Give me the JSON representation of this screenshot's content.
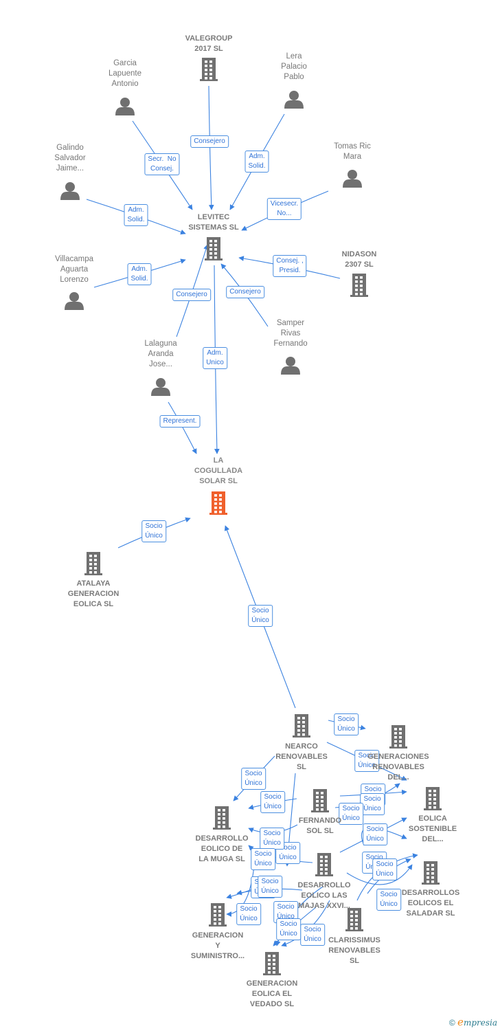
{
  "colors": {
    "edge": "#3b82e0",
    "icon": "#707070",
    "highlight": "#f0602c",
    "label": "#777777"
  },
  "nodes": [
    {
      "name": "VALEGROUP 2017  SL",
      "lines": [
        "VALEGROUP",
        "2017  SL"
      ],
      "type": "company"
    },
    {
      "name": "Garcia Lapuente Antonio",
      "lines": [
        "Garcia",
        "Lapuente",
        "Antonio"
      ],
      "type": "person"
    },
    {
      "name": "Lera Palacio Pablo",
      "lines": [
        "Lera",
        "Palacio",
        "Pablo"
      ],
      "type": "person"
    },
    {
      "name": "Galindo Salvador Jaime...",
      "lines": [
        "Galindo",
        "Salvador",
        "Jaime..."
      ],
      "type": "person"
    },
    {
      "name": "Tomas Ric Mara",
      "lines": [
        "Tomas Ric",
        "Mara"
      ],
      "type": "person"
    },
    {
      "name": "LEVITEC SISTEMAS SL",
      "lines": [
        "LEVITEC",
        "SISTEMAS  SL"
      ],
      "type": "company"
    },
    {
      "name": "Villacampa Aguarta Lorenzo",
      "lines": [
        "Villacampa",
        "Aguarta",
        "Lorenzo"
      ],
      "type": "person"
    },
    {
      "name": "NIDASON 2307 SL",
      "lines": [
        "NIDASON",
        "2307  SL"
      ],
      "type": "company"
    },
    {
      "name": "Samper Rivas Fernando",
      "lines": [
        "Samper",
        "Rivas",
        "Fernando"
      ],
      "type": "person"
    },
    {
      "name": "Lalaguna Aranda Jose...",
      "lines": [
        "Lalaguna",
        "Aranda",
        "Jose..."
      ],
      "type": "person"
    },
    {
      "name": "LA COGULLADA SOLAR SL",
      "lines": [
        "LA",
        "COGULLADA",
        "SOLAR  SL"
      ],
      "type": "company",
      "highlight": true
    },
    {
      "name": "ATALAYA GENERACION EOLICA SL",
      "lines": [
        "ATALAYA",
        "GENERACION",
        "EOLICA  SL"
      ],
      "type": "company"
    },
    {
      "name": "NEARCO RENOVABLES SL",
      "lines": [
        "NEARCO",
        "RENOVABLES",
        "SL"
      ],
      "type": "company"
    },
    {
      "name": "GENERACIONES RENOVABLES DEL...",
      "lines": [
        "GENERACIONES",
        "RENOVABLES",
        "DEL..."
      ],
      "type": "company"
    },
    {
      "name": "FERNANDO SOL SL",
      "lines": [
        "FERNANDO",
        "SOL SL"
      ],
      "type": "company"
    },
    {
      "name": "EOLICA SOSTENIBLE DEL...",
      "lines": [
        "EOLICA",
        "SOSTENIBLE",
        "DEL..."
      ],
      "type": "company"
    },
    {
      "name": "DESARROLLO EOLICO DE LA MUGA SL",
      "lines": [
        "DESARROLLO",
        "EOLICO DE",
        "LA MUGA SL"
      ],
      "type": "company"
    },
    {
      "name": "DESARROLLO EOLICO LAS MAJAS XXVI...",
      "lines": [
        "DESARROLLO",
        "EOLICO LAS",
        "MAJAS XXVI..."
      ],
      "type": "company"
    },
    {
      "name": "DESARROLLOS EOLICOS EL SALADAR SL",
      "lines": [
        "DESARROLLOS",
        "EOLICOS EL",
        "SALADAR SL"
      ],
      "type": "company"
    },
    {
      "name": "CLARISSIMUS RENOVABLES SL",
      "lines": [
        "CLARISSIMUS",
        "RENOVABLES",
        "SL"
      ],
      "type": "company"
    },
    {
      "name": "GENERACION Y SUMINISTRO...",
      "lines": [
        "GENERACION",
        "Y",
        "SUMINISTRO..."
      ],
      "type": "company"
    },
    {
      "name": "GENERACION EOLICA EL VEDADO SL",
      "lines": [
        "GENERACION",
        "EOLICA EL",
        "VEDADO SL"
      ],
      "type": "company"
    }
  ],
  "edges": [
    {
      "from": 1,
      "to": 5,
      "label": "Secr.  No\nConsej."
    },
    {
      "from": 0,
      "to": 5,
      "label": "Consejero"
    },
    {
      "from": 2,
      "to": 5,
      "label": "Adm.\nSolid."
    },
    {
      "from": 3,
      "to": 5,
      "label": "Adm.\nSolid."
    },
    {
      "from": 4,
      "to": 5,
      "label": "Vicesecr.\nNo..."
    },
    {
      "from": 6,
      "to": 5,
      "label": "Adm.\nSolid."
    },
    {
      "from": 7,
      "to": 5,
      "label": "Consej. ,\nPresid."
    },
    {
      "from": 9,
      "to": 5,
      "label": "Consejero"
    },
    {
      "from": 8,
      "to": 5,
      "label": "Consejero"
    },
    {
      "from": 5,
      "to": 10,
      "label": "Adm.\nUnico"
    },
    {
      "from": 9,
      "to": 10,
      "label": "Represent."
    },
    {
      "from": 11,
      "to": 10,
      "label": "Socio\nÚnico"
    },
    {
      "from": 12,
      "to": 10,
      "label": "Socio\nÚnico"
    },
    {
      "from": 12,
      "to": 13,
      "label": "Socio\nÚnico"
    },
    {
      "from": 12,
      "to": 15,
      "label": "Socio\nÚnico"
    },
    {
      "from": 12,
      "to": 16,
      "label": "Socio\nÚnico"
    },
    {
      "from": 14,
      "to": 16,
      "label": "Socio\nÚnico"
    },
    {
      "from": 14,
      "to": 15,
      "label": "Socio\nÚnico"
    },
    {
      "from": 14,
      "to": 13,
      "label": "Socio\nÚnico"
    },
    {
      "from": 17,
      "to": 15,
      "label": "Socio\nÚnico"
    },
    {
      "from": 19,
      "to": 15,
      "label": "Socio\nÚnico"
    },
    {
      "from": 17,
      "to": 18,
      "label": "Socio\nÚnico"
    },
    {
      "from": 19,
      "to": 18,
      "label": "Socio\nÚnico"
    },
    {
      "from": 12,
      "to": 16,
      "label": "Socio\nÚnico"
    },
    {
      "from": 14,
      "to": 16,
      "label": "Socio\nÚnico"
    },
    {
      "from": 17,
      "to": 16,
      "label": "Socio\nÚnico"
    },
    {
      "from": 17,
      "to": 20,
      "label": "Socio\nÚnico"
    },
    {
      "from": 19,
      "to": 20,
      "label": "Socio\nÚnico"
    },
    {
      "from": 19,
      "to": 21,
      "label": "Socio\nÚnico"
    },
    {
      "from": 17,
      "to": 21,
      "label": "Socio\nÚnico"
    },
    {
      "from": 19,
      "to": 21,
      "label": "Socio\nÚnico"
    },
    {
      "from": 16,
      "to": 20,
      "label": "Socio\nÚnico"
    },
    {
      "from": 19,
      "to": 18,
      "label": "Socio\nÚnico"
    }
  ],
  "footer": {
    "copyright": "©",
    "brand_initial": "e",
    "brand_rest": "mpresia"
  }
}
